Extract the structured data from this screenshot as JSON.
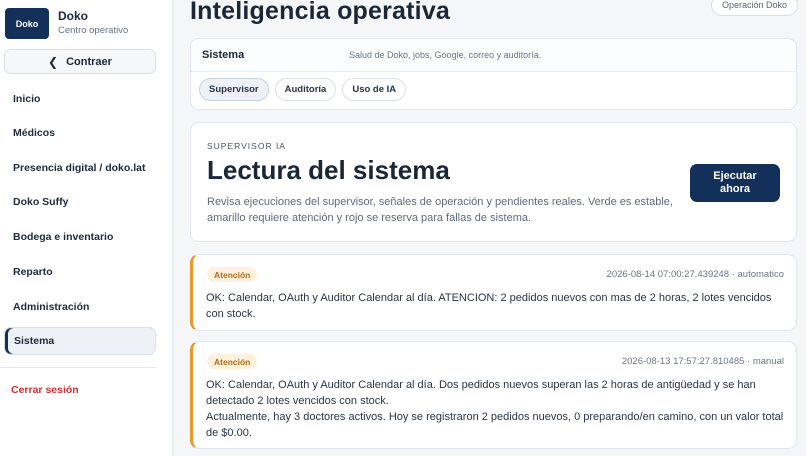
{
  "brand": {
    "logo": "Doko",
    "name": "Doko",
    "subtitle": "Centro operativo"
  },
  "sidebar": {
    "collapse_label": "Contraer",
    "collapse_icon": "chevron-left-icon",
    "items": [
      {
        "label": "Inicio",
        "active": false
      },
      {
        "label": "Médicos",
        "active": false
      },
      {
        "label": "Presencia digital / doko.lat",
        "active": false
      },
      {
        "label": "Doko Suffy",
        "active": false
      },
      {
        "label": "Bodega e inventario",
        "active": false
      },
      {
        "label": "Reparto",
        "active": false
      },
      {
        "label": "Administración",
        "active": false
      },
      {
        "label": "Sistema",
        "active": true
      }
    ],
    "logout_label": "Cerrar sesión"
  },
  "header": {
    "title": "Inteligencia operativa",
    "chip": "Operación Doko"
  },
  "system": {
    "title": "Sistema",
    "description": "Salud de Doko, jobs, Google, correo y auditoría.",
    "tabs": [
      {
        "label": "Supervisor",
        "active": true
      },
      {
        "label": "Auditoría",
        "active": false
      },
      {
        "label": "Uso de IA",
        "active": false
      }
    ]
  },
  "supervisor": {
    "eyebrow": "SUPERVISOR IA",
    "title": "Lectura del sistema",
    "description": "Revisa ejecuciones del supervisor, señales de operación y pendientes reales. Verde es estable, amarillo requiere atención y rojo se reserva para fallas de sistema.",
    "run_button": "Ejecutar ahora"
  },
  "logs": [
    {
      "badge": "Atención",
      "meta": "2026-08-14 07:00:27.439248 · automatico",
      "text": "OK: Calendar, OAuth y Auditor Calendar al día. ATENCION: 2 pedidos nuevos con mas de 2 horas, 2 lotes vencidos con stock."
    },
    {
      "badge": "Atención",
      "meta": "2026-08-13 17:57:27.810485 · manual",
      "text": "OK: Calendar, OAuth y Auditor Calendar al día. Dos pedidos nuevos superan las 2 horas de antigüedad y se han detectado 2 lotes vencidos con stock.",
      "text2": "Actualmente, hay 3 doctores activos. Hoy se registraron 2 pedidos nuevos, 0 preparando/en camino, con un valor total de $0.00."
    }
  ],
  "colors": {
    "brand": "#13305a",
    "attention": "#e9962b",
    "danger": "#d32f2f"
  }
}
